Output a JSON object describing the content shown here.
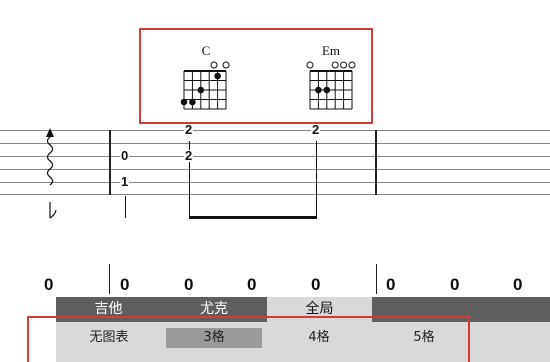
{
  "chords": [
    {
      "name": "C"
    },
    {
      "name": "Em"
    }
  ],
  "tab": {
    "numbers": [
      "2",
      "0",
      "2",
      "1",
      "2"
    ]
  },
  "counts": [
    "0",
    "0",
    "0",
    "0",
    "0",
    "0",
    "0",
    "0"
  ],
  "panel": {
    "tabs": [
      "吉他",
      "尤克",
      "全局"
    ],
    "active_tab": "全局",
    "options": [
      "无图表",
      "3格",
      "4格",
      "5格"
    ],
    "selected_option": "3格"
  },
  "colors": {
    "highlight_box": "#d43a3a",
    "panel_tab_bar": "#5e5e5e",
    "panel_bg": "#d9d9d9",
    "selected_option": "#9a9a9a"
  }
}
